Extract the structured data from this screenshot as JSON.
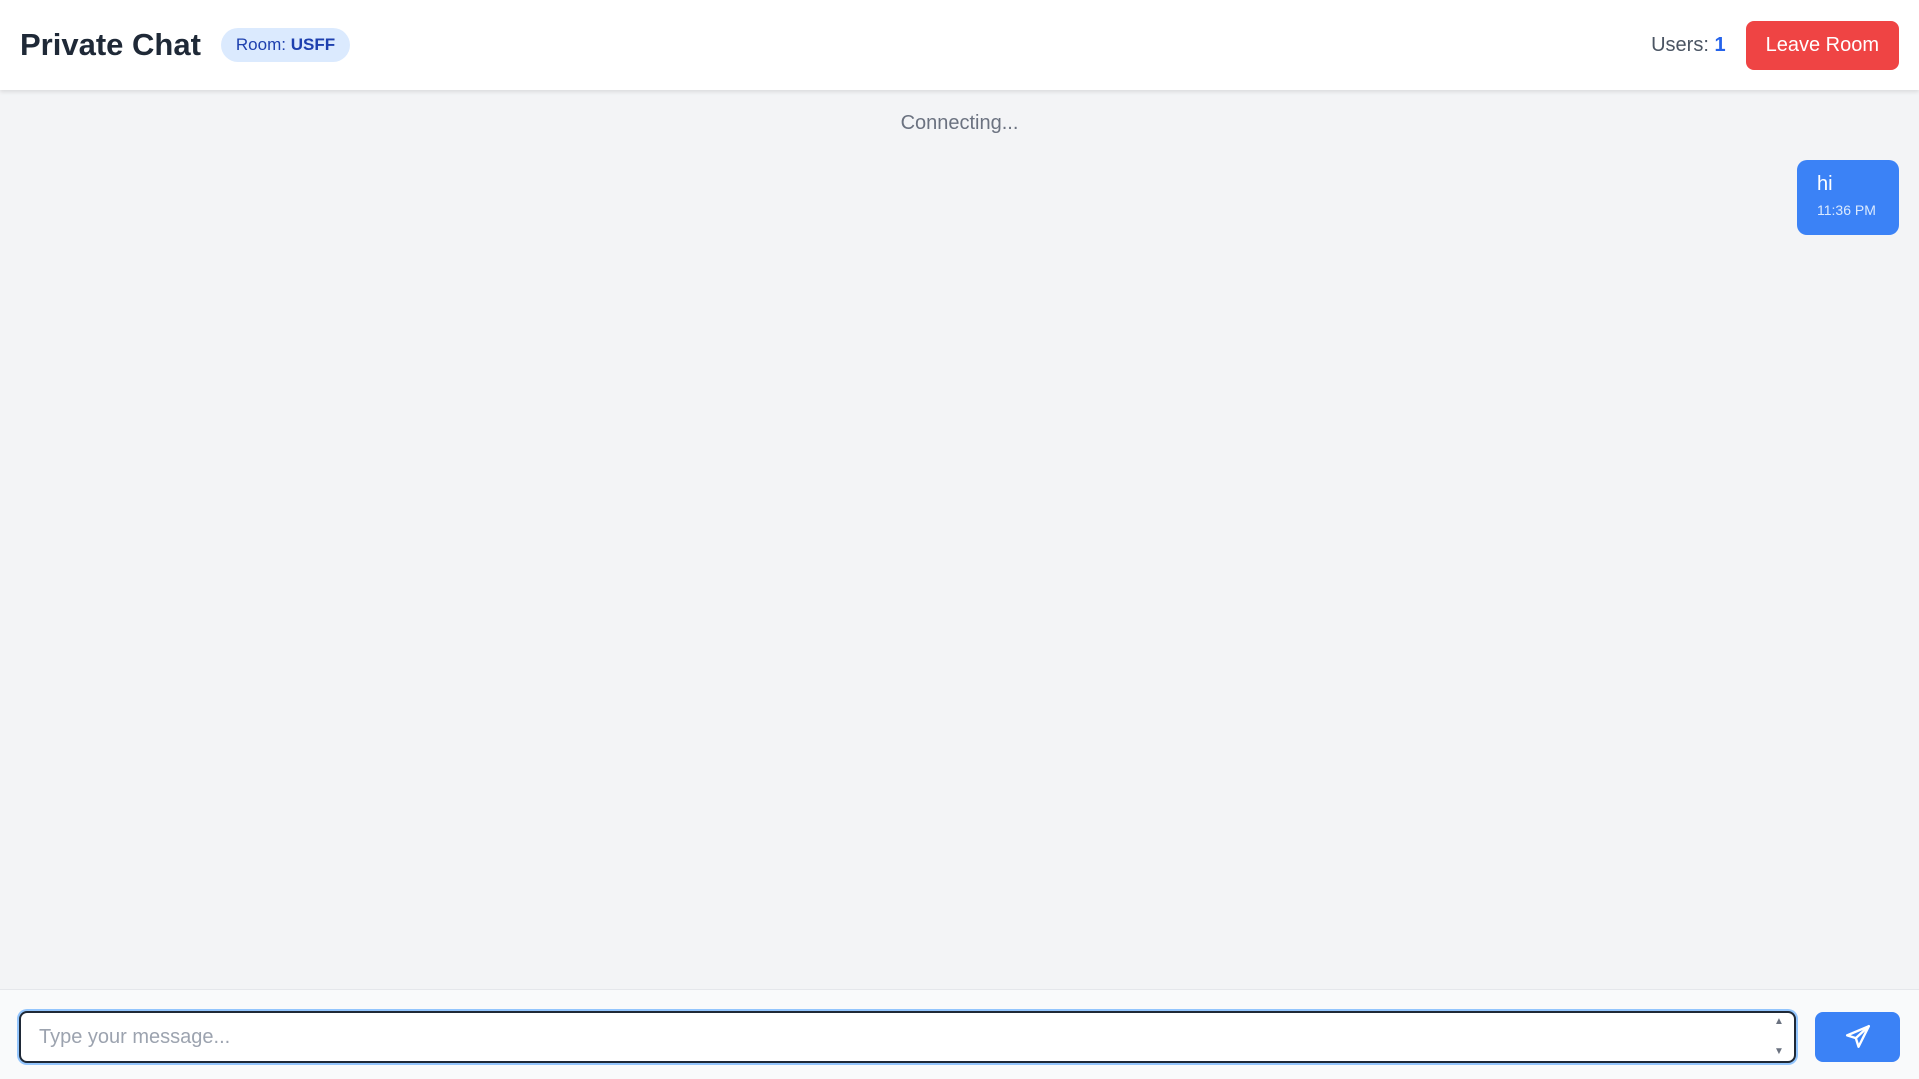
{
  "header": {
    "title": "Private Chat",
    "room_label": "Room:",
    "room_code": "USFF",
    "users_label": "Users:",
    "users_count": "1",
    "leave_label": "Leave Room"
  },
  "chat": {
    "status": "Connecting...",
    "messages": [
      {
        "text": "hi",
        "time": "11:36 PM",
        "own": true
      }
    ]
  },
  "composer": {
    "placeholder": "Type your message...",
    "value": "",
    "send_icon": "paper-plane-icon"
  },
  "colors": {
    "accent": "#3b82f6",
    "danger": "#ef4444",
    "badge_bg": "#dbeafe",
    "badge_text": "#1e40af",
    "background": "#f3f4f6"
  }
}
